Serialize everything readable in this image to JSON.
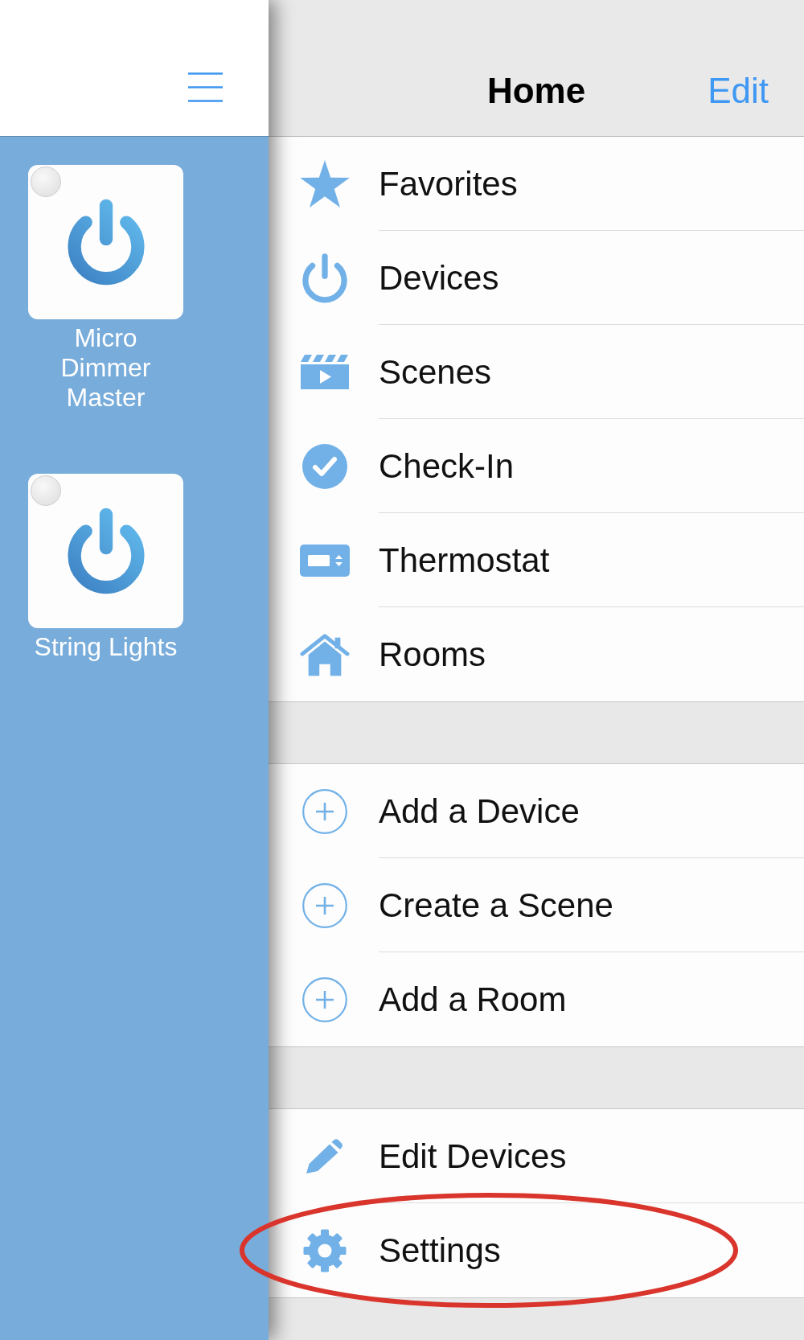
{
  "sidebar": {
    "devices": [
      {
        "name": "Micro Dimmer Master",
        "on": false
      },
      {
        "name": "String Lights",
        "on": false
      }
    ]
  },
  "navigation_bar": {
    "title": "Home",
    "edit_button": "Edit"
  },
  "menu": {
    "sections": [
      {
        "items": [
          {
            "label": "Favorites",
            "highlighted": false
          },
          {
            "label": "Devices",
            "highlighted": false
          },
          {
            "label": "Scenes",
            "highlighted": false
          },
          {
            "label": "Check-In",
            "highlighted": false
          },
          {
            "label": "Thermostat",
            "highlighted": false
          },
          {
            "label": "Rooms",
            "highlighted": false
          }
        ]
      },
      {
        "items": [
          {
            "label": "Add a Device",
            "highlighted": false
          },
          {
            "label": "Create a Scene",
            "highlighted": false
          },
          {
            "label": "Add a Room",
            "highlighted": false
          }
        ]
      },
      {
        "items": [
          {
            "label": "Edit Devices",
            "highlighted": false
          },
          {
            "label": "Settings",
            "highlighted": true
          }
        ]
      }
    ]
  }
}
